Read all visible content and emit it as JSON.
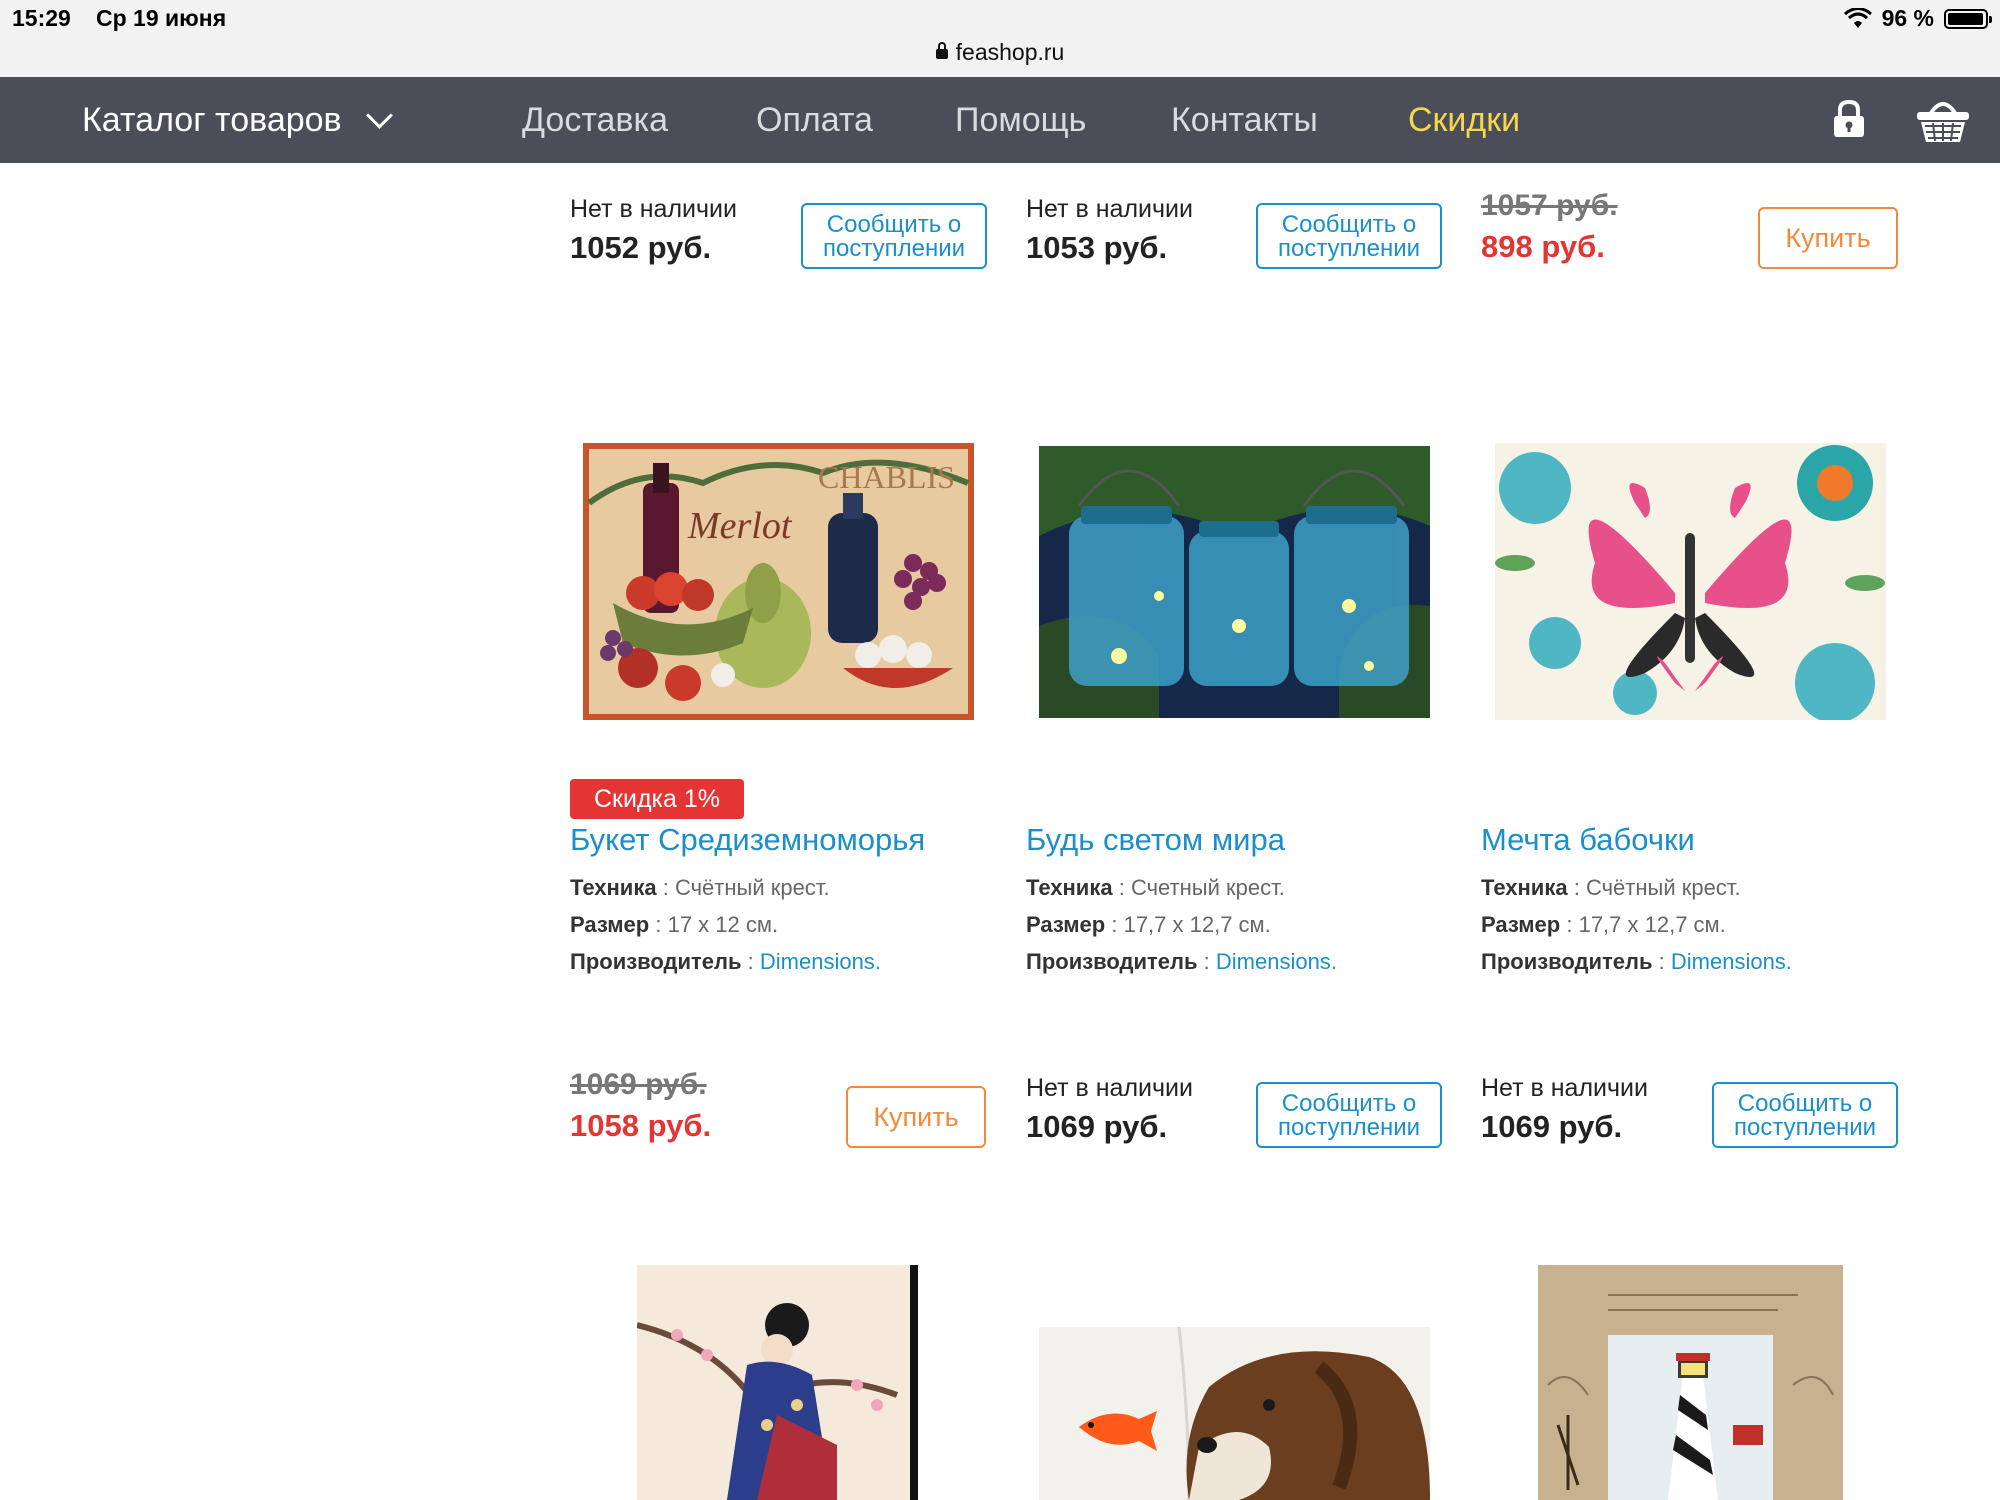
{
  "status_bar": {
    "time": "15:29",
    "date": "Ср 19 июня",
    "url": "feashop.ru",
    "battery": "96 %",
    "battery_level": 0.96
  },
  "nav": {
    "catalog_label": "Каталог товаров",
    "links": [
      "Доставка",
      "Оплата",
      "Помощь",
      "Контакты",
      "Скидки"
    ],
    "sale_color": "#f6d84c",
    "icons": [
      "lock-icon",
      "basket-icon"
    ]
  },
  "colors": {
    "link": "#1a8fc9",
    "sale_red": "#e53434",
    "buy_orange": "#f28a3d",
    "nav_bg": "#4b4e58"
  },
  "row1": [
    {
      "stock": "Нет в наличии",
      "price": "1052 руб.",
      "button": "Сообщить о поступлении"
    },
    {
      "stock": "Нет в наличии",
      "price": "1053 руб.",
      "button": "Сообщить о поступлении"
    },
    {
      "old_price": "1057 руб.",
      "price": "898 руб.",
      "button": "Купить"
    }
  ],
  "products": [
    {
      "badge": "Скидка 1%",
      "title": "Букет Средиземноморья",
      "tech_label": "Техника",
      "tech": "Счётный крест.",
      "size_label": "Размер",
      "size": "17 х 12 см.",
      "maker_label": "Производитель",
      "maker": "Dimensions.",
      "image_words": [
        "CHABLIS",
        "Merlot"
      ],
      "old_price": "1069 руб.",
      "price": "1058 руб.",
      "button": "Купить"
    },
    {
      "title": "Будь светом мира",
      "tech_label": "Техника",
      "tech": "Счетный крест.",
      "size_label": "Размер",
      "size": "17,7 х 12,7 см.",
      "maker_label": "Производитель",
      "maker": "Dimensions.",
      "stock": "Нет в наличии",
      "price": "1069 руб.",
      "button": "Сообщить о поступлении"
    },
    {
      "title": "Мечта бабочки",
      "tech_label": "Техника",
      "tech": "Счётный крест.",
      "size_label": "Размер",
      "size": "17,7 х 12,7 см.",
      "maker_label": "Производитель",
      "maker": "Dimensions.",
      "stock": "Нет в наличии",
      "price": "1069 руб.",
      "button": "Сообщить о поступлении"
    }
  ]
}
